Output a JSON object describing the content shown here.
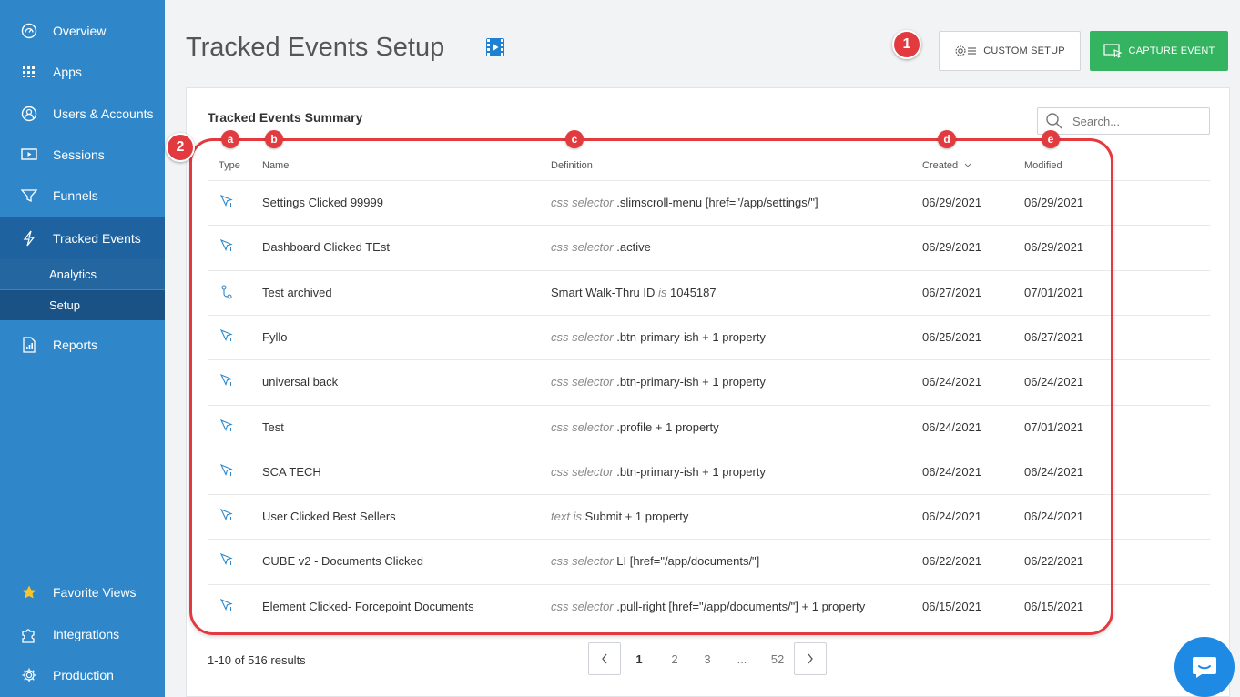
{
  "sidebar": {
    "items": [
      {
        "label": "Overview",
        "icon": "gauge-icon"
      },
      {
        "label": "Apps",
        "icon": "grid-icon"
      },
      {
        "label": "Users & Accounts",
        "icon": "user-circle-icon"
      },
      {
        "label": "Sessions",
        "icon": "play-screen-icon"
      },
      {
        "label": "Funnels",
        "icon": "funnel-icon"
      },
      {
        "label": "Tracked Events",
        "icon": "lightning-icon"
      }
    ],
    "subitems": [
      {
        "label": "Analytics"
      },
      {
        "label": "Setup"
      }
    ],
    "reports": {
      "label": "Reports",
      "icon": "report-icon"
    },
    "bottom_items": [
      {
        "label": "Favorite Views",
        "icon": "star-icon"
      },
      {
        "label": "Integrations",
        "icon": "puzzle-icon"
      },
      {
        "label": "Production",
        "icon": "gear-icon"
      }
    ]
  },
  "header": {
    "title": "Tracked Events Setup",
    "custom_setup_label": "CUSTOM SETUP",
    "capture_event_label": "CAPTURE EVENT"
  },
  "summary": {
    "title": "Tracked Events Summary",
    "search_placeholder": "Search..."
  },
  "table": {
    "columns": {
      "type": "Type",
      "name": "Name",
      "definition": "Definition",
      "created": "Created",
      "modified": "Modified"
    },
    "rows": [
      {
        "type_icon": "click-icon",
        "name": "Settings Clicked 99999",
        "def_kw": "css selector",
        "def_val": ".slimscroll-menu [href=\"/app/settings/\"]",
        "created": "06/29/2021",
        "modified": "06/29/2021"
      },
      {
        "type_icon": "click-icon",
        "name": "Dashboard Clicked TEst",
        "def_kw": "css selector",
        "def_val": ".active",
        "created": "06/29/2021",
        "modified": "06/29/2021"
      },
      {
        "type_icon": "walkthru-icon",
        "name": "Test archived",
        "def_pre": "Smart Walk-Thru ID",
        "def_kw": "is",
        "def_val": "1045187",
        "created": "06/27/2021",
        "modified": "07/01/2021"
      },
      {
        "type_icon": "click-icon",
        "name": "Fyllo",
        "def_kw": "css selector",
        "def_val": ".btn-primary-ish + 1 property",
        "created": "06/25/2021",
        "modified": "06/27/2021"
      },
      {
        "type_icon": "click-icon",
        "name": "universal back",
        "def_kw": "css selector",
        "def_val": ".btn-primary-ish + 1 property",
        "created": "06/24/2021",
        "modified": "06/24/2021"
      },
      {
        "type_icon": "click-icon",
        "name": "Test",
        "def_kw": "css selector",
        "def_val": ".profile + 1 property",
        "created": "06/24/2021",
        "modified": "07/01/2021"
      },
      {
        "type_icon": "click-icon",
        "name": "SCA TECH",
        "def_kw": "css selector",
        "def_val": ".btn-primary-ish + 1 property",
        "created": "06/24/2021",
        "modified": "06/24/2021"
      },
      {
        "type_icon": "click-icon",
        "name": "User Clicked Best Sellers",
        "def_kw": "text is",
        "def_val": "Submit + 1 property",
        "created": "06/24/2021",
        "modified": "06/24/2021"
      },
      {
        "type_icon": "click-icon",
        "name": "CUBE v2 - Documents Clicked",
        "def_kw": "css selector",
        "def_val": "LI [href=\"/app/documents/\"]",
        "created": "06/22/2021",
        "modified": "06/22/2021"
      },
      {
        "type_icon": "click-icon",
        "name": "Element Clicked- Forcepoint Documents",
        "def_kw": "css selector",
        "def_val": ".pull-right [href=\"/app/documents/\"] + 1 property",
        "created": "06/15/2021",
        "modified": "06/15/2021"
      }
    ]
  },
  "callouts": {
    "one": "1",
    "two": "2",
    "a": "a",
    "b": "b",
    "c": "c",
    "d": "d",
    "e": "e"
  },
  "pagination": {
    "results": "1-10 of 516 results",
    "pages": [
      "1",
      "2",
      "3",
      "...",
      "52"
    ]
  },
  "colors": {
    "sidebar": "#2f86c8",
    "accent_green": "#34b460",
    "callout_red": "#e23a3f"
  }
}
